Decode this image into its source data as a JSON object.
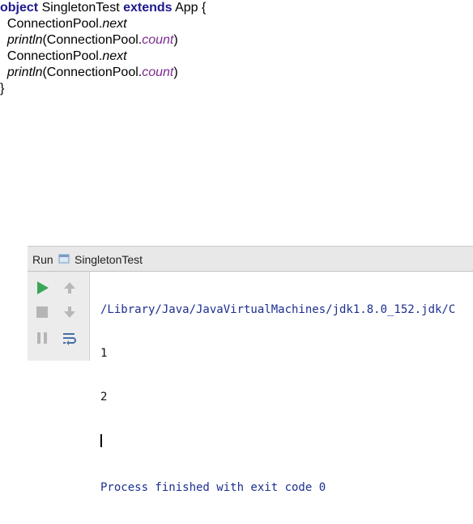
{
  "code": {
    "line1": {
      "kw1": "object",
      "name": " SingletonTest ",
      "kw2": "extends",
      "rest": " App {"
    },
    "line2": {
      "obj": "ConnectionPool.",
      "member": "next"
    },
    "line3": {
      "fn": "println",
      "open": "(ConnectionPool.",
      "member": "count",
      "close": ")"
    },
    "line4": {
      "obj": "ConnectionPool.",
      "member": "next"
    },
    "line5": {
      "fn": "println",
      "open": "(ConnectionPool.",
      "member": "count",
      "close": ")"
    },
    "line6": "}"
  },
  "run_panel": {
    "run_label": "Run",
    "tab_label": "SingletonTest",
    "console": {
      "path_line": "/Library/Java/JavaVirtualMachines/jdk1.8.0_152.jdk/C",
      "output": [
        "1",
        "2"
      ],
      "finished_line": "Process finished with exit code 0"
    }
  },
  "colors": {
    "keyword": "#1e1a8c",
    "member_italic": "#7a2b8f",
    "run_green": "#3aa655",
    "console_blue": "#1d2f8f"
  },
  "icons": [
    "run-icon",
    "stop-icon",
    "pause-icon",
    "scroll-up-icon",
    "scroll-down-icon",
    "soft-wrap-icon",
    "tab-icon"
  ]
}
